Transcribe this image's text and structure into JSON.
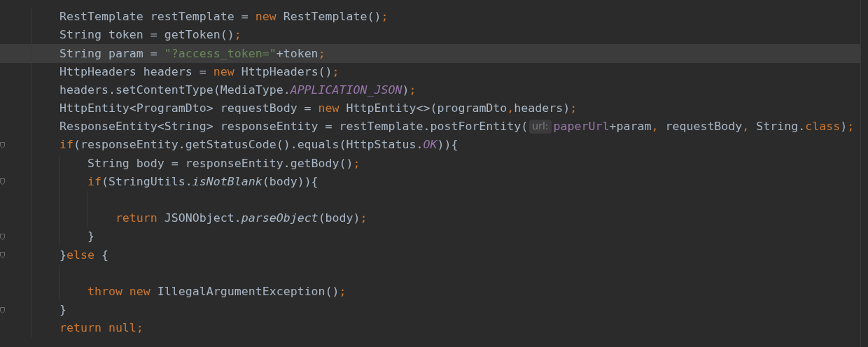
{
  "editor": {
    "lines": [
      {
        "current": false,
        "fold": false,
        "tokens": [
          {
            "kind": "plain",
            "text": "    RestTemplate restTemplate = "
          },
          {
            "kind": "keyword",
            "text": "new"
          },
          {
            "kind": "plain",
            "text": " RestTemplate()"
          },
          {
            "kind": "keyword",
            "text": ";"
          }
        ]
      },
      {
        "current": false,
        "fold": false,
        "tokens": [
          {
            "kind": "plain",
            "text": "    String token = getToken()"
          },
          {
            "kind": "keyword",
            "text": ";"
          }
        ]
      },
      {
        "current": true,
        "fold": false,
        "tokens": [
          {
            "kind": "plain",
            "text": "    String param = "
          },
          {
            "kind": "string",
            "text": "\"?access_token=\""
          },
          {
            "kind": "plain",
            "text": "+token"
          },
          {
            "kind": "keyword",
            "text": ";"
          }
        ]
      },
      {
        "current": false,
        "fold": false,
        "tokens": [
          {
            "kind": "plain",
            "text": "    HttpHeaders headers = "
          },
          {
            "kind": "keyword",
            "text": "new"
          },
          {
            "kind": "plain",
            "text": " HttpHeaders()"
          },
          {
            "kind": "keyword",
            "text": ";"
          }
        ]
      },
      {
        "current": false,
        "fold": false,
        "tokens": [
          {
            "kind": "plain",
            "text": "    headers.setContentType(MediaType."
          },
          {
            "kind": "constant",
            "text": "APPLICATION_JSON"
          },
          {
            "kind": "plain",
            "text": ")"
          },
          {
            "kind": "keyword",
            "text": ";"
          }
        ]
      },
      {
        "current": false,
        "fold": false,
        "tokens": [
          {
            "kind": "plain",
            "text": "    HttpEntity<ProgramDto> requestBody = "
          },
          {
            "kind": "keyword",
            "text": "new"
          },
          {
            "kind": "plain",
            "text": " HttpEntity<>(programDto"
          },
          {
            "kind": "keyword",
            "text": ","
          },
          {
            "kind": "plain",
            "text": "headers)"
          },
          {
            "kind": "keyword",
            "text": ";"
          }
        ]
      },
      {
        "current": false,
        "fold": false,
        "tokens": [
          {
            "kind": "plain",
            "text": "    ResponseEntity<String> responseEntity = restTemplate.postForEntity("
          },
          {
            "kind": "hint",
            "text": "url:"
          },
          {
            "kind": "field",
            "text": "paperUrl"
          },
          {
            "kind": "plain",
            "text": "+param"
          },
          {
            "kind": "keyword",
            "text": ", "
          },
          {
            "kind": "plain",
            "text": "requestBody"
          },
          {
            "kind": "keyword",
            "text": ", "
          },
          {
            "kind": "plain",
            "text": "String."
          },
          {
            "kind": "keyword",
            "text": "class"
          },
          {
            "kind": "plain",
            "text": ")"
          },
          {
            "kind": "keyword",
            "text": ";"
          }
        ]
      },
      {
        "current": false,
        "fold": true,
        "tokens": [
          {
            "kind": "keyword",
            "text": "    if"
          },
          {
            "kind": "plain",
            "text": "(responseEntity.getStatusCode().equals(HttpStatus."
          },
          {
            "kind": "constant",
            "text": "OK"
          },
          {
            "kind": "plain",
            "text": ")){"
          }
        ]
      },
      {
        "current": false,
        "fold": false,
        "tokens": [
          {
            "kind": "plain",
            "text": "        String body = responseEntity.getBody()"
          },
          {
            "kind": "keyword",
            "text": ";"
          }
        ]
      },
      {
        "current": false,
        "fold": true,
        "tokens": [
          {
            "kind": "keyword",
            "text": "        if"
          },
          {
            "kind": "plain",
            "text": "(StringUtils."
          },
          {
            "kind": "static",
            "text": "isNotBlank"
          },
          {
            "kind": "plain",
            "text": "(body)){"
          }
        ]
      },
      {
        "current": false,
        "fold": false
      },
      {
        "current": false,
        "fold": false,
        "tokens": [
          {
            "kind": "keyword",
            "text": "            return"
          },
          {
            "kind": "plain",
            "text": " JSONObject."
          },
          {
            "kind": "static",
            "text": "parseObject"
          },
          {
            "kind": "plain",
            "text": "(body)"
          },
          {
            "kind": "keyword",
            "text": ";"
          }
        ]
      },
      {
        "current": false,
        "fold": true,
        "tokens": [
          {
            "kind": "plain",
            "text": "        }"
          }
        ]
      },
      {
        "current": false,
        "fold": true,
        "tokens": [
          {
            "kind": "plain",
            "text": "    }"
          },
          {
            "kind": "keyword",
            "text": "else"
          },
          {
            "kind": "plain",
            "text": " {"
          }
        ]
      },
      {
        "current": false,
        "fold": false
      },
      {
        "current": false,
        "fold": false,
        "tokens": [
          {
            "kind": "keyword",
            "text": "        throw new"
          },
          {
            "kind": "plain",
            "text": " IllegalArgumentException()"
          },
          {
            "kind": "keyword",
            "text": ";"
          }
        ]
      },
      {
        "current": false,
        "fold": true,
        "tokens": [
          {
            "kind": "plain",
            "text": "    }"
          }
        ]
      },
      {
        "current": false,
        "fold": false,
        "tokens": [
          {
            "kind": "keyword",
            "text": "    return null;"
          }
        ]
      }
    ]
  }
}
